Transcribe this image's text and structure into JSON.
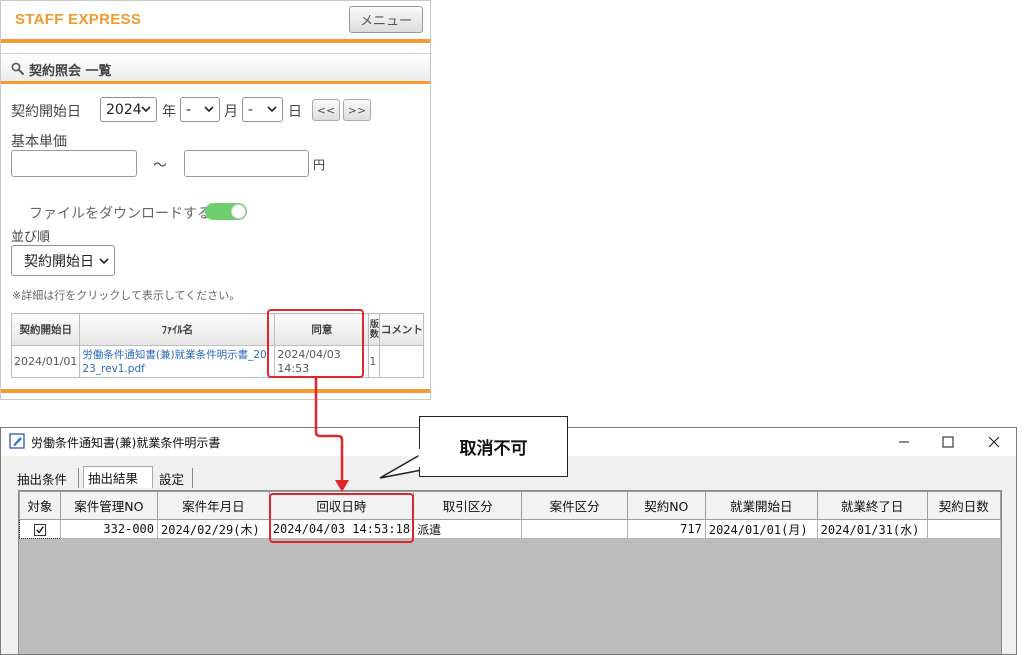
{
  "web": {
    "brand": "STAFF EXPRESS",
    "menu_label": "メニュー",
    "section_title": "契約照会 一覧",
    "start_date_label": "契約開始日",
    "year_value": "2024",
    "year_suffix": "年",
    "month_value": "-",
    "month_suffix": "月",
    "day_value": "-",
    "day_suffix": "日",
    "prev_label": "<<",
    "next_label": ">>",
    "unit_price_label": "基本単価",
    "tilde": "～",
    "yen": "円",
    "download_label": "ファイルをダウンロードする",
    "download_enabled": true,
    "sort_label": "並び順",
    "sort_value": "契約開始日",
    "note": "※詳細は行をクリックして表示してください。",
    "table": {
      "headers": [
        "契約開始日",
        "ﾌｧｲﾙ名",
        "同意",
        "版数",
        "コメント"
      ],
      "rows": [
        {
          "start": "2024/01/01",
          "file": "労働条件通知書(兼)就業条件明示書_2023_rev1.pdf",
          "agree": "2024/04/03 14:53",
          "version": "1",
          "comment": ""
        }
      ]
    }
  },
  "window": {
    "title": "労働条件通知書(兼)就業条件明示書",
    "tabs": [
      "抽出条件",
      "抽出結果",
      "設定"
    ],
    "active_tab": "抽出結果",
    "columns": [
      "対象",
      "案件管理NO",
      "案件年月日",
      "回収日時",
      "取引区分",
      "案件区分",
      "契約NO",
      "就業開始日",
      "就業終了日",
      "契約日数"
    ],
    "rows": [
      {
        "checked": true,
        "case_no": "332-000",
        "case_date": "2024/02/29(木)",
        "collected_at": "2024/04/03 14:53:18",
        "trade_type": "派遣",
        "case_type": "",
        "contract_no": "717",
        "work_start": "2024/01/01(月)",
        "work_end": "2024/01/31(水)",
        "days": ""
      }
    ]
  },
  "callout": "取消不可",
  "colors": {
    "brand": "#f09a2a",
    "highlight": "#e0262b",
    "toggle_on": "#6fcf6f"
  }
}
